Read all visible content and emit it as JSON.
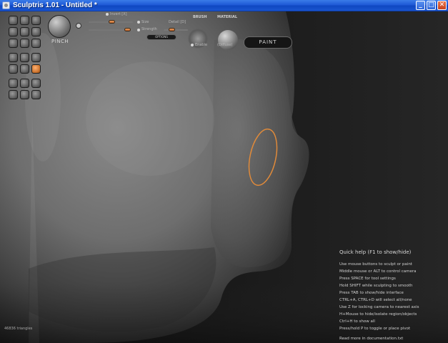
{
  "window": {
    "title": "Sculptris 1.01 - Untitled *",
    "buttons": {
      "minimize": "_",
      "maximize": "□",
      "close": "✕"
    }
  },
  "toolbar": {
    "brush_name": "PINCH",
    "invert_label": "Invert [X]",
    "size_label": "Size",
    "detail_label": "Detail [D]",
    "strength_label": "Strength",
    "options_label": "OPTIONS",
    "brush_section": "BRUSH",
    "material_section": "MATERIAL",
    "paint_label": "PAINT",
    "material_name": "(Diffuse)",
    "brush_sub_label": "Enable",
    "slider_values": {
      "size": 0.55,
      "strength": 0.75,
      "detail": 0.5
    }
  },
  "help": {
    "title": "Quick help (F1 to show/hide)",
    "lines": [
      "Use mouse buttons to sculpt or paint",
      "Middle mouse or ALT to control camera",
      "Press SPACE for tool settings",
      "Hold SHIFT while sculpting to smooth",
      "Press TAB to show/hide interface",
      "CTRL+A, CTRL+D will select all/none",
      "Use Z for locking camera to nearest axis",
      "H+Mouse to hide/isolate region/objects",
      "Ctrl+H to show all",
      "Press/hold P to toggle or place pivot"
    ],
    "read_more": "Read more in documentation.txt"
  },
  "status": {
    "triangles": "46836 triangles"
  },
  "colors": {
    "accent": "#e08a3a",
    "titlebar": "#1f5ad6"
  }
}
